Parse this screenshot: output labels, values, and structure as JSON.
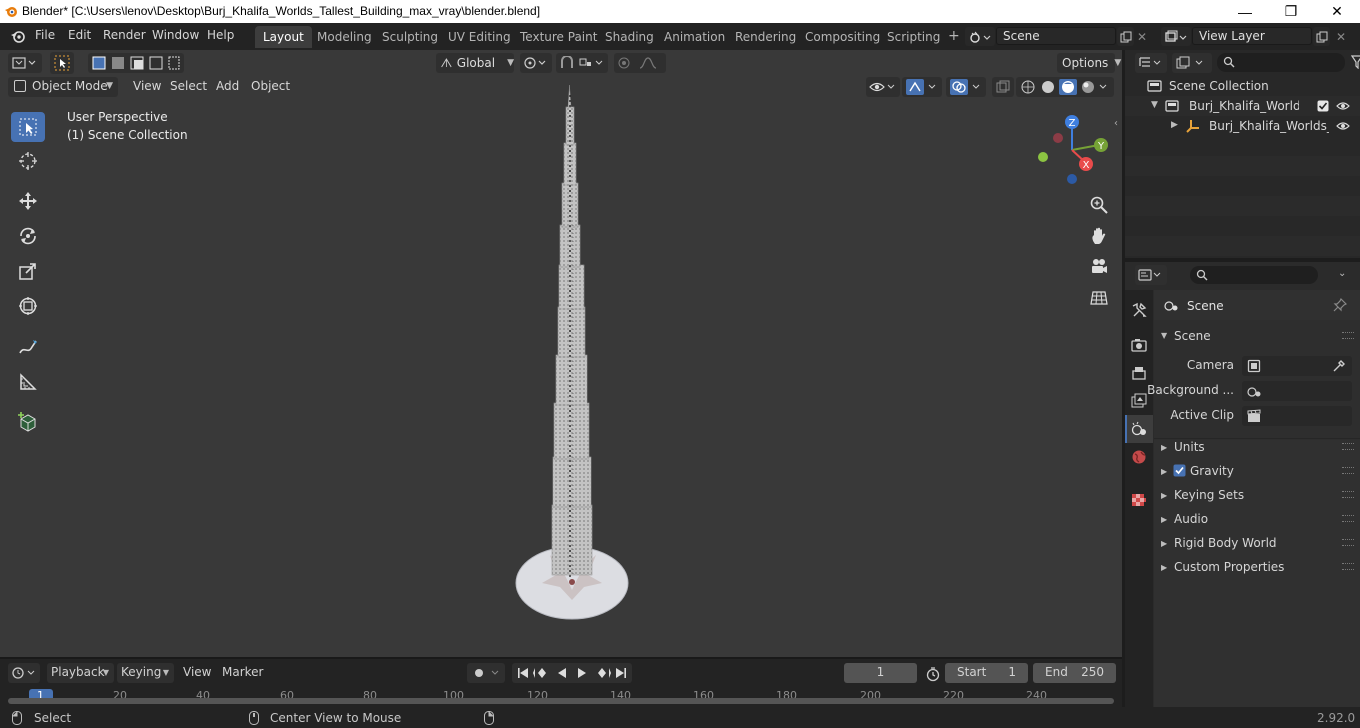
{
  "window": {
    "title": "Blender* [C:\\Users\\lenov\\Desktop\\Burj_Khalifa_Worlds_Tallest_Building_max_vray\\blender.blend]",
    "minimize": "—",
    "maximize": "❐",
    "close": "✕"
  },
  "menu": {
    "items": [
      "File",
      "Edit",
      "Render",
      "Window",
      "Help"
    ]
  },
  "workspaces": {
    "tabs": [
      "Layout",
      "Modeling",
      "Sculpting",
      "UV Editing",
      "Texture Paint",
      "Shading",
      "Animation",
      "Rendering",
      "Compositing",
      "Scripting"
    ],
    "active": "Layout",
    "add": "+"
  },
  "scene_selector": {
    "value": "Scene"
  },
  "view_layer_selector": {
    "value": "View Layer"
  },
  "viewport_header": {
    "transform_orientation": "Global",
    "options": "Options",
    "mode": "Object Mode",
    "view": "View",
    "select": "Select",
    "add": "Add",
    "object": "Object"
  },
  "viewport_overlay": {
    "perspective": "User Perspective",
    "collection": "(1) Scene Collection"
  },
  "gizmo": {
    "z": "Z",
    "y": "Y",
    "x": "X"
  },
  "outliner": {
    "root": "Scene Collection",
    "collection": "Burj_Khalifa_Worlds_Tallest_Building",
    "object": "Burj_Khalifa_Worlds_Tallest_Building"
  },
  "properties": {
    "context": "Scene",
    "panel_scene": "Scene",
    "camera_label": "Camera",
    "background_label": "Background ...",
    "clip_label": "Active Clip",
    "panels": [
      "Units",
      "Gravity",
      "Keying Sets",
      "Audio",
      "Rigid Body World",
      "Custom Properties"
    ],
    "gravity_enabled": true
  },
  "timeline": {
    "playback": "Playback",
    "keying": "Keying",
    "view": "View",
    "marker": "Marker",
    "current_frame": "1",
    "start_label": "Start",
    "start_value": "1",
    "end_label": "End",
    "end_value": "250",
    "ruler": [
      "1",
      "20",
      "40",
      "60",
      "80",
      "100",
      "120",
      "140",
      "160",
      "180",
      "200",
      "220",
      "240"
    ]
  },
  "statusbar": {
    "select": "Select",
    "center_view": "Center View to Mouse",
    "version": "2.92.0"
  },
  "colors": {
    "accent": "#4772b3",
    "x_axis": "#e94b4b",
    "y_axis": "#76a236",
    "z_axis": "#3f7fe0"
  }
}
